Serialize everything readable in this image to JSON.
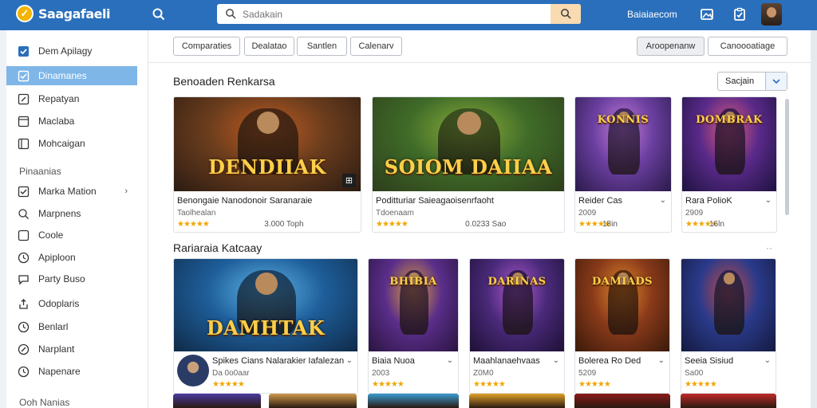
{
  "header": {
    "logo_text": "Saagafaeli",
    "logo_mark": "✓",
    "search_placeholder": "Sadakain",
    "link": "Baiaiaecom",
    "icons": [
      "search-icon",
      "image-icon",
      "clipboard-check-icon"
    ]
  },
  "sidebar": {
    "items": [
      {
        "label": "Dem Apilagy",
        "icon": "check-icon"
      },
      {
        "label": "Dinamanes",
        "icon": "check-square-icon",
        "active": true
      },
      {
        "label": "Repatyan",
        "icon": "edit-icon"
      },
      {
        "label": "Maclaba",
        "icon": "square-icon"
      },
      {
        "label": "Mohcaigan",
        "icon": "square-icon"
      }
    ],
    "section": "Pinaanias",
    "items2": [
      {
        "label": "Marka Mation",
        "icon": "check-square-icon"
      },
      {
        "label": "Marpnens",
        "icon": "search-icon"
      },
      {
        "label": "Coole",
        "icon": "square-icon"
      },
      {
        "label": "Apiploon",
        "icon": "clock-icon"
      },
      {
        "label": "Party Buso",
        "icon": "chat-icon"
      },
      {
        "label": "Odoplaris",
        "icon": "share-icon"
      },
      {
        "label": "Benlarl",
        "icon": "clock-icon"
      },
      {
        "label": "Narplant",
        "icon": "edit-icon"
      },
      {
        "label": "Napenare",
        "icon": "clock-icon"
      }
    ],
    "footer": "Ooh Nanias"
  },
  "filters": {
    "left": [
      "Comparaties",
      "Dealatao",
      "Santlen",
      "Calenarv"
    ],
    "right": [
      "Aroopenanw",
      "Canoooatiage"
    ]
  },
  "section1": {
    "title": "Benoaden Renkarsa",
    "sort_label": "Sacjain",
    "cards": [
      {
        "art": "DENDIIAK",
        "name": "Benongaie Nanodonoir Saranaraie",
        "meta": "Taolhealan",
        "stars": "★★★★★",
        "price": "3.000 Toph",
        "palette": [
          "#6b3d1d",
          "#c05a1f",
          "#2b1b12"
        ]
      },
      {
        "art": "SOIOM DAIIAA",
        "name": "Poditturiar Saieagaoisenrfaoht",
        "meta": "Tdoenaam",
        "stars": "★★★★★",
        "price": "0.0233 Sao",
        "palette": [
          "#3f6b28",
          "#8cae3a",
          "#2d3d1b"
        ]
      },
      {
        "art": "KONNIS",
        "name": "Reider Cas",
        "meta": "2009",
        "stars": "★★★★★",
        "price": "18in",
        "palette": [
          "#6b3fa0",
          "#c67ed8",
          "#2a1a4a"
        ]
      },
      {
        "art": "DOMBRAK",
        "name": "Rara PolioK",
        "meta": "2909",
        "stars": "★★★★★",
        "price": "16ln",
        "palette": [
          "#5a2a8a",
          "#e05a7a",
          "#1e1240"
        ]
      }
    ]
  },
  "section2": {
    "title": "Rariaraia Katcaay",
    "more": "··",
    "cards": [
      {
        "art": "DAMHTAK",
        "name": "Spikes Cians Nalarakier Iafalezan",
        "meta": "Da 0o0aar",
        "stars": "★★★★★",
        "price": "",
        "palette": [
          "#1e5e9a",
          "#5fb6e6",
          "#0f2a48"
        ]
      },
      {
        "art": "BHIBIA",
        "name": "Biaia Nuoa",
        "meta": "2003",
        "stars": "★★★★★",
        "price": "",
        "palette": [
          "#5a2e8a",
          "#e0a03a",
          "#2a1440"
        ]
      },
      {
        "art": "DARINAS",
        "name": "Maahlanaehvaas",
        "meta": "Z0M0",
        "stars": "★★★★★",
        "price": "",
        "palette": [
          "#4a2a7a",
          "#b05ad0",
          "#1e1036"
        ]
      },
      {
        "art": "DAMIADS",
        "name": "Bolerea Ro Ded",
        "meta": "5209",
        "stars": "★★★★★",
        "price": "",
        "palette": [
          "#8a3a1a",
          "#e0882a",
          "#3a1a0a"
        ]
      },
      {
        "art": "",
        "name": "Seeia Sisiud",
        "meta": "Sa00",
        "stars": "★★★★★",
        "price": "",
        "palette": [
          "#2a3a8a",
          "#c04a4a",
          "#141a40"
        ]
      }
    ]
  },
  "peek_palettes": [
    "#4a3aa0",
    "#d09a4a",
    "#3a9ad0",
    "#e0a02a",
    "#8a1a1a",
    "#c02a2a"
  ]
}
